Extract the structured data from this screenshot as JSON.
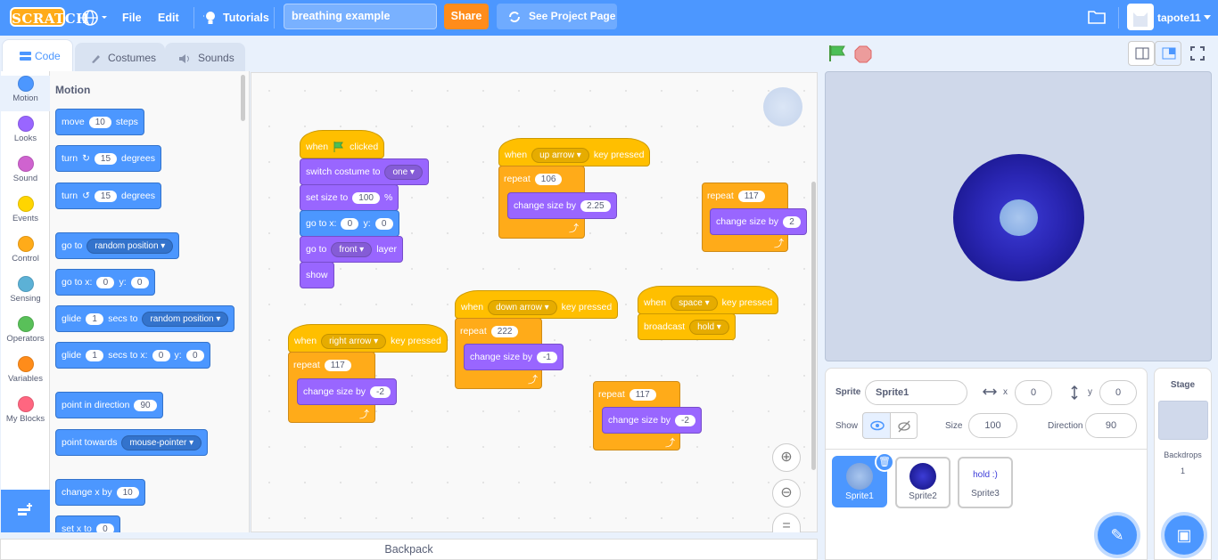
{
  "menubar": {
    "logo": "SCRATCH",
    "file": "File",
    "edit": "Edit",
    "tutorials": "Tutorials",
    "project_title": "breathing example",
    "share": "Share",
    "see_project": "See Project Page",
    "username": "tapote11"
  },
  "tabs": {
    "code": "Code",
    "costumes": "Costumes",
    "sounds": "Sounds"
  },
  "categories": [
    {
      "label": "Motion",
      "color": "#4c97ff"
    },
    {
      "label": "Looks",
      "color": "#9966ff"
    },
    {
      "label": "Sound",
      "color": "#cf63cf"
    },
    {
      "label": "Events",
      "color": "#ffd500"
    },
    {
      "label": "Control",
      "color": "#ffab19"
    },
    {
      "label": "Sensing",
      "color": "#5cb1d6"
    },
    {
      "label": "Operators",
      "color": "#59c059"
    },
    {
      "label": "Variables",
      "color": "#ff8c1a"
    },
    {
      "label": "My Blocks",
      "color": "#ff6680"
    }
  ],
  "palette": {
    "title": "Motion",
    "move": {
      "a": "move",
      "v": "10",
      "b": "steps"
    },
    "turn_r": {
      "a": "turn",
      "v": "15",
      "b": "degrees"
    },
    "turn_l": {
      "a": "turn",
      "v": "15",
      "b": "degrees"
    },
    "goto": {
      "a": "go to",
      "d": "random position"
    },
    "gotoxy": {
      "a": "go to x:",
      "x": "0",
      "b": "y:",
      "y": "0"
    },
    "glide1": {
      "a": "glide",
      "v": "1",
      "b": "secs to",
      "d": "random position"
    },
    "glide2": {
      "a": "glide",
      "v": "1",
      "b": "secs to x:",
      "x": "0",
      "c": "y:",
      "y": "0"
    },
    "point_dir": {
      "a": "point in direction",
      "v": "90"
    },
    "point_towards": {
      "a": "point towards",
      "d": "mouse-pointer"
    },
    "change_x": {
      "a": "change x by",
      "v": "10"
    },
    "set_x": {
      "a": "set x to",
      "v": "0"
    }
  },
  "scripts": {
    "s1": {
      "when": "when",
      "clicked": "clicked",
      "switch": "switch costume to",
      "costume": "one",
      "setsize": "set size to",
      "size": "100",
      "pct": "%",
      "gotox": "go to x:",
      "x": "0",
      "y_lbl": "y:",
      "y": "0",
      "goto": "go to",
      "layer_dd": "front",
      "layer": "layer",
      "show": "show"
    },
    "s2": {
      "when": "when",
      "key": "up arrow",
      "kp": "key pressed",
      "repeat": "repeat",
      "n": "106",
      "change": "change size by",
      "by": "2.25"
    },
    "s3": {
      "repeat": "repeat",
      "n": "117",
      "change": "change size by",
      "by": "2"
    },
    "s4": {
      "when": "when",
      "key": "right arrow",
      "kp": "key pressed",
      "repeat": "repeat",
      "n": "117",
      "change": "change size by",
      "by": "-2"
    },
    "s5": {
      "when": "when",
      "key": "down arrow",
      "kp": "key pressed",
      "repeat": "repeat",
      "n": "222",
      "change": "change size by",
      "by": "-1"
    },
    "s6": {
      "when": "when",
      "key": "space",
      "kp": "key pressed",
      "broadcast": "broadcast",
      "msg": "hold"
    },
    "s7": {
      "repeat": "repeat",
      "n": "117",
      "change": "change size by",
      "by": "-2"
    }
  },
  "backpack": "Backpack",
  "sprite_info": {
    "sprite_lbl": "Sprite",
    "sprite_name": "Sprite1",
    "x_lbl": "x",
    "x": "0",
    "y_lbl": "y",
    "y": "0",
    "show_lbl": "Show",
    "size_lbl": "Size",
    "size": "100",
    "dir_lbl": "Direction",
    "dir": "90"
  },
  "sprites": [
    {
      "name": "Sprite1"
    },
    {
      "name": "Sprite2"
    },
    {
      "name": "Sprite3",
      "thumb_text": "hold :)"
    }
  ],
  "stage_panel": {
    "title": "Stage",
    "backdrops_lbl": "Backdrops",
    "backdrops": "1"
  }
}
